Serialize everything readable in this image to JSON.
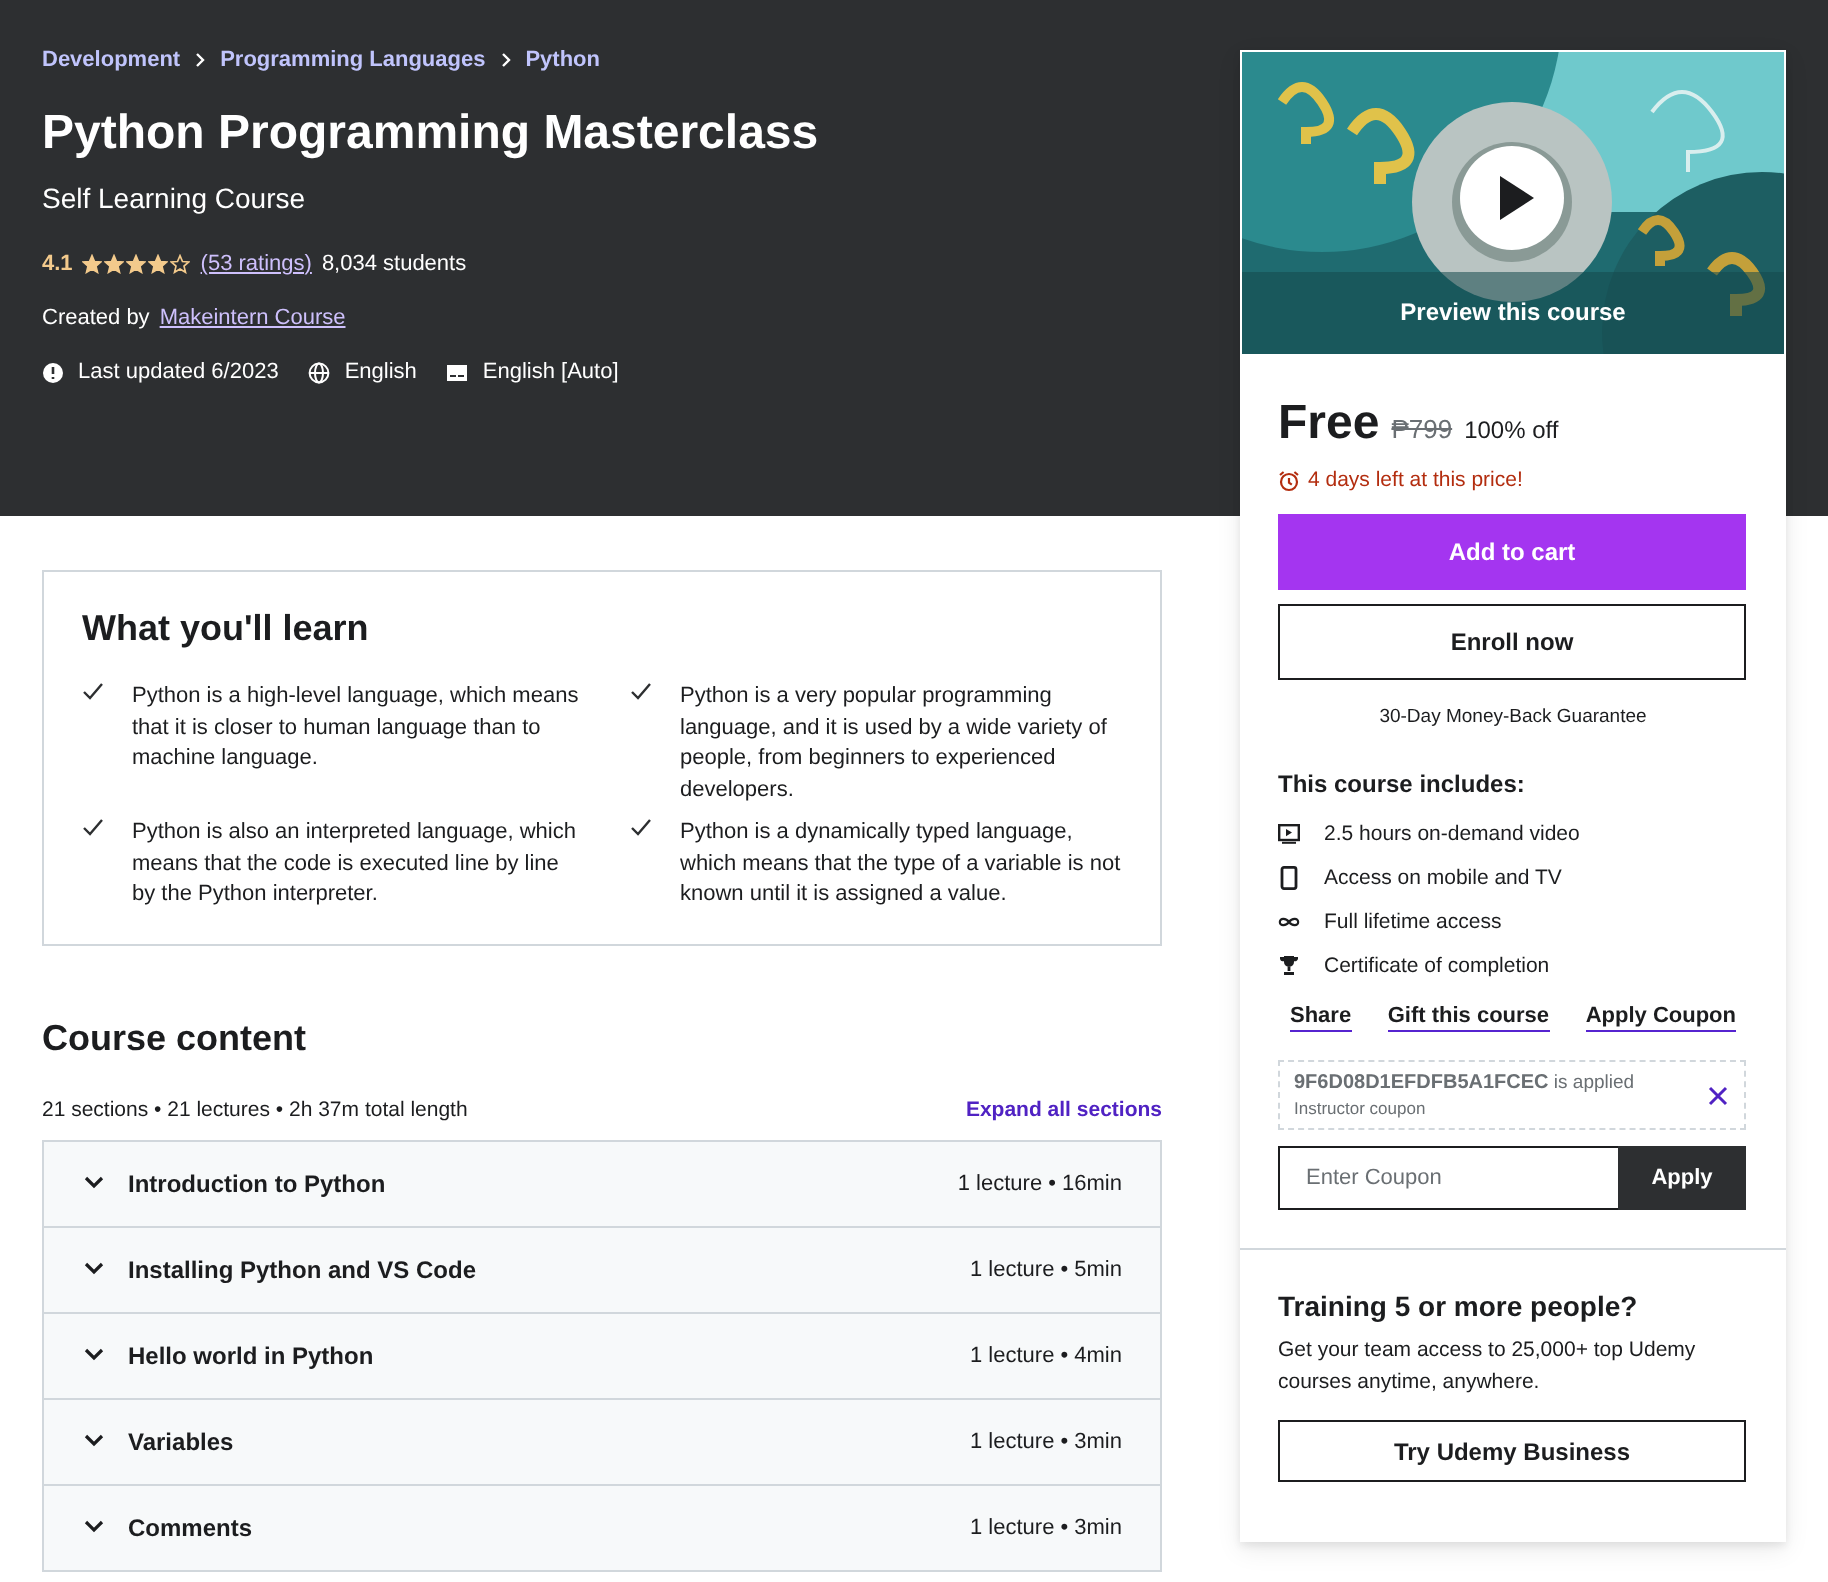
{
  "breadcrumb": [
    "Development",
    "Programming Languages",
    "Python"
  ],
  "course": {
    "title": "Python Programming Masterclass",
    "subtitle": "Self Learning Course",
    "rating": "4.1",
    "stars": 4,
    "ratings_link": "(53 ratings)",
    "students": "8,034 students",
    "created_by": "Created by",
    "author": "Makeintern Course",
    "last_updated": "Last updated 6/2023",
    "language": "English",
    "captions": "English [Auto]"
  },
  "learn": {
    "title": "What you'll learn",
    "items": [
      "Python is a high-level language, which means that it is closer to human language than to machine language.",
      "Python is a very popular programming language, and it is used by a wide variety of people, from beginners to experienced developers.",
      "Python is also an interpreted language, which means that the code is executed line by line by the Python interpreter.",
      "Python is a dynamically typed language, which means that the type of a variable is not known until it is assigned a value."
    ]
  },
  "content": {
    "title": "Course content",
    "summary": "21 sections • 21 lectures • 2h 37m total length",
    "expand_link": "Expand all sections",
    "sections": [
      {
        "title": "Introduction to Python",
        "meta": "1 lecture • 16min",
        "expanded": false
      },
      {
        "title": "Installing Python and VS Code",
        "meta": "1 lecture • 5min",
        "expanded": false
      },
      {
        "title": "Hello world in Python",
        "meta": "1 lecture • 4min",
        "expanded": false
      },
      {
        "title": "Variables",
        "meta": "1 lecture • 3min",
        "expanded": false
      },
      {
        "title": "Comments",
        "meta": "1 lecture • 3min",
        "expanded": false
      }
    ]
  },
  "sidebar": {
    "preview_label": "Preview this course",
    "price": "Free",
    "original_price": "₱799",
    "discount": "100% off",
    "deadline": "4 days left at this price!",
    "add_to_cart": "Add to cart",
    "enroll": "Enroll now",
    "guarantee": "30-Day Money-Back Guarantee",
    "includes_title": "This course includes:",
    "includes": [
      {
        "kind": "video",
        "text": "2.5 hours on-demand video"
      },
      {
        "kind": "mobile",
        "text": "Access on mobile and TV"
      },
      {
        "kind": "infinity",
        "text": "Full lifetime access"
      },
      {
        "kind": "trophy",
        "text": "Certificate of completion"
      }
    ],
    "links": [
      "Share",
      "Gift this course",
      "Apply Coupon"
    ],
    "coupon": {
      "code": "9F6D08D1EFDFB5A1FCEC",
      "status": "is applied",
      "note": "Instructor coupon"
    },
    "coupon_field": {
      "placeholder": "Enter Coupon",
      "button": "Apply"
    },
    "business": {
      "title": "Training 5 or more people?",
      "text": "Get your team access to 25,000+ top Udemy courses anytime, anywhere.",
      "button": "Try Udemy Business"
    }
  }
}
